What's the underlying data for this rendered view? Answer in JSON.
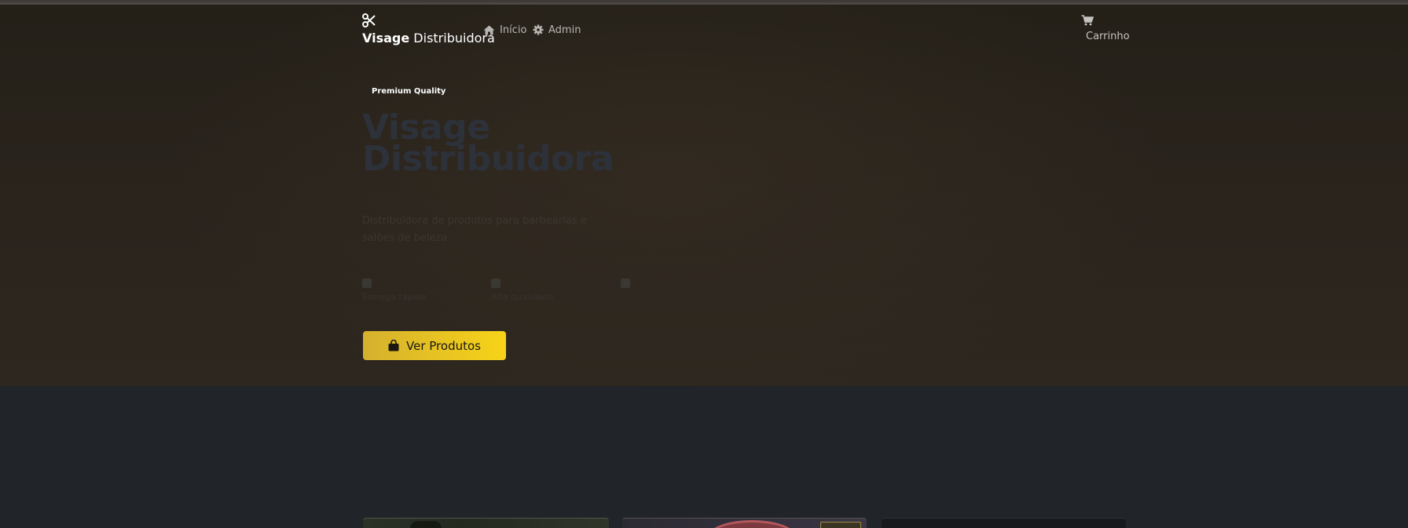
{
  "nav": {
    "brand_bold": "Visage",
    "brand_regular": " Distribuidora",
    "home_label": "Início",
    "admin_label": "Admin",
    "cart_label": "Carrinho"
  },
  "hero": {
    "badge": "Premium Quality",
    "title_line1": "Visage",
    "title_line2": "Distribuidora",
    "subtitle": "Distribuidora de produtos para barbearias e salões de beleza",
    "features": [
      {
        "label": "Entrega rápida"
      },
      {
        "label": "Alta qualidade"
      },
      {
        "label": ""
      }
    ],
    "cta_label": "Ver Produtos"
  },
  "colors": {
    "accent_start": "#d4b12e",
    "accent_end": "#f7d318",
    "background": "#212429",
    "hero_background": "#2a241d"
  },
  "icons": {
    "brand": "scissors-icon",
    "home": "home-icon",
    "admin": "gear-icon",
    "cart": "shopping-cart-icon",
    "cta": "shopping-bag-icon"
  }
}
